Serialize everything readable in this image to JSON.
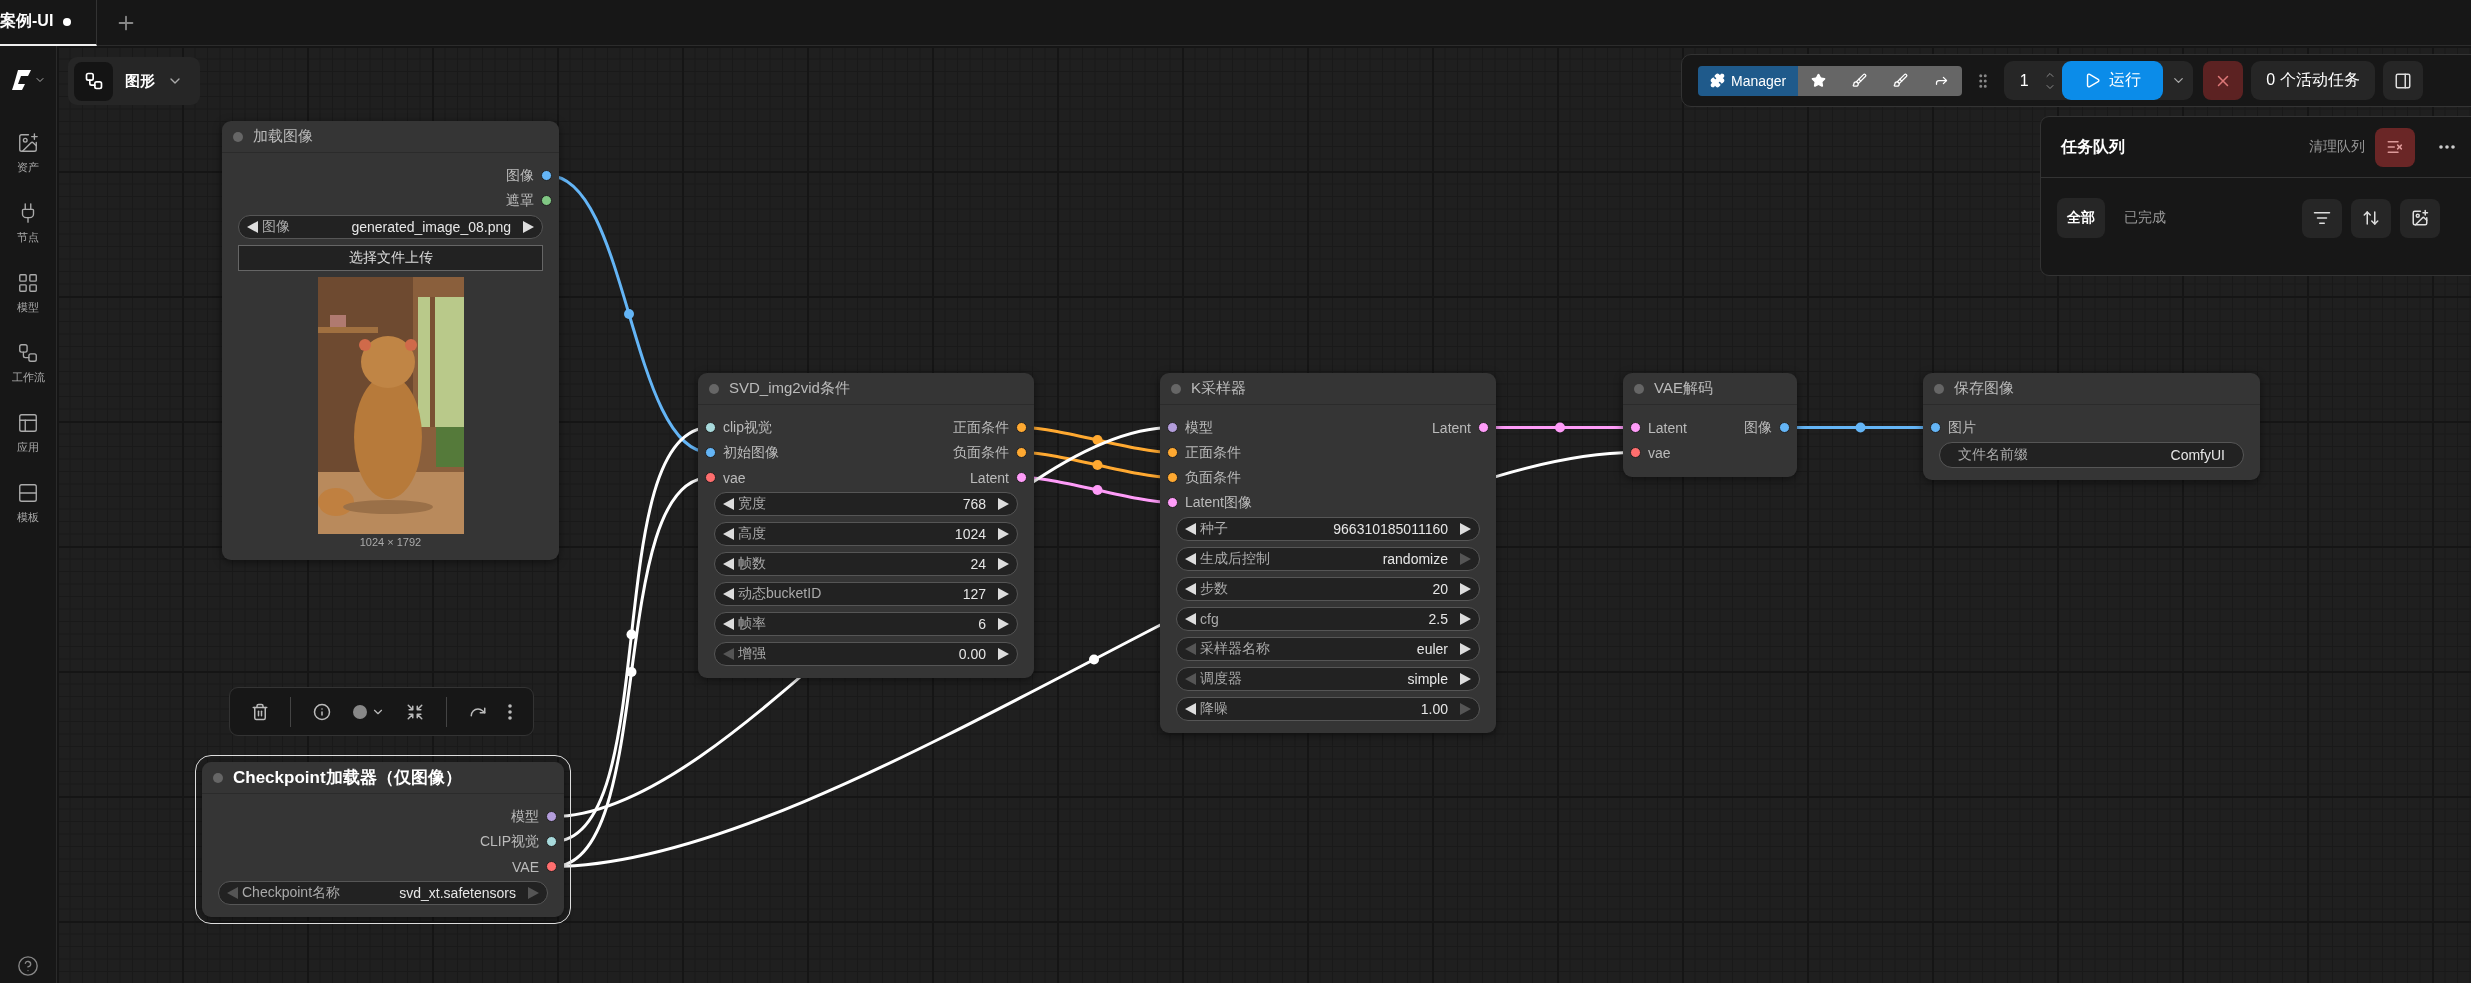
{
  "tabs": [
    {
      "label": "案例-UI",
      "selected": true,
      "modified": true
    }
  ],
  "sidebar": {
    "items": [
      {
        "label": "资产"
      },
      {
        "label": "节点"
      },
      {
        "label": "模型"
      },
      {
        "label": "工作流"
      },
      {
        "label": "应用"
      },
      {
        "label": "模板"
      }
    ]
  },
  "view_switch": {
    "label": "图形"
  },
  "toolbar": {
    "manager": "Manager",
    "batch_count": "1",
    "run": "运行",
    "active_tasks": "0 个活动任务"
  },
  "queue_panel": {
    "title": "任务队列",
    "clear": "清理队列",
    "tabs": [
      {
        "label": "全部",
        "selected": true
      },
      {
        "label": "已完成",
        "selected": false
      }
    ]
  },
  "nodes": [
    {
      "title": "加载图像",
      "selected": false,
      "outputs": [
        {
          "label": "图像",
          "color": "#64b5f6"
        },
        {
          "label": "遮罩",
          "color": "#81c784"
        }
      ],
      "widgets": [
        {
          "kind": "combo",
          "label": "图像",
          "value": "generated_image_08.png",
          "prev_disabled": false,
          "next_disabled": false
        },
        {
          "kind": "button",
          "label": "选择文件上传"
        }
      ],
      "preview": {
        "kind": "picture",
        "caption": "1024 × 1792"
      }
    },
    {
      "title": "SVD_img2vid条件",
      "selected": false,
      "inputs": [
        {
          "label": "clip视觉",
          "color": "#a8dadc"
        },
        {
          "label": "初始图像",
          "color": "#64b5f6"
        },
        {
          "label": "vae",
          "color": "#ff6e6e"
        }
      ],
      "outputs": [
        {
          "label": "正面条件",
          "color": "#ffa931"
        },
        {
          "label": "负面条件",
          "color": "#ffa931"
        },
        {
          "label": "Latent",
          "color": "#ff9cf9"
        }
      ],
      "widgets": [
        {
          "kind": "number",
          "label": "宽度",
          "value": "768",
          "prev_disabled": false,
          "next_disabled": false
        },
        {
          "kind": "number",
          "label": "高度",
          "value": "1024",
          "prev_disabled": false,
          "next_disabled": false
        },
        {
          "kind": "number",
          "label": "帧数",
          "value": "24",
          "prev_disabled": false,
          "next_disabled": false
        },
        {
          "kind": "number",
          "label": "动态bucketID",
          "value": "127",
          "prev_disabled": false,
          "next_disabled": false
        },
        {
          "kind": "number",
          "label": "帧率",
          "value": "6",
          "prev_disabled": false,
          "next_disabled": false
        },
        {
          "kind": "number",
          "label": "增强",
          "value": "0.00",
          "prev_disabled": true,
          "next_disabled": false
        }
      ]
    },
    {
      "title": "K采样器",
      "selected": false,
      "inputs": [
        {
          "label": "模型",
          "color": "#b39ddb"
        },
        {
          "label": "正面条件",
          "color": "#ffa931"
        },
        {
          "label": "负面条件",
          "color": "#ffa931"
        },
        {
          "label": "Latent图像",
          "color": "#ff9cf9"
        }
      ],
      "outputs": [
        {
          "label": "Latent",
          "color": "#ff9cf9"
        }
      ],
      "widgets": [
        {
          "kind": "number",
          "label": "种子",
          "value": "966310185011160",
          "prev_disabled": false,
          "next_disabled": false
        },
        {
          "kind": "combo",
          "label": "生成后控制",
          "value": "randomize",
          "prev_disabled": false,
          "next_disabled": true
        },
        {
          "kind": "number",
          "label": "步数",
          "value": "20",
          "prev_disabled": false,
          "next_disabled": false
        },
        {
          "kind": "number",
          "label": "cfg",
          "value": "2.5",
          "prev_disabled": false,
          "next_disabled": false
        },
        {
          "kind": "combo",
          "label": "采样器名称",
          "value": "euler",
          "prev_disabled": true,
          "next_disabled": false
        },
        {
          "kind": "combo",
          "label": "调度器",
          "value": "simple",
          "prev_disabled": true,
          "next_disabled": false
        },
        {
          "kind": "number",
          "label": "降噪",
          "value": "1.00",
          "prev_disabled": false,
          "next_disabled": true
        }
      ]
    },
    {
      "title": "VAE解码",
      "selected": false,
      "inputs": [
        {
          "label": "Latent",
          "color": "#ff9cf9"
        },
        {
          "label": "vae",
          "color": "#ff6e6e"
        }
      ],
      "outputs": [
        {
          "label": "图像",
          "color": "#64b5f6"
        }
      ]
    },
    {
      "title": "保存图像",
      "selected": false,
      "inputs": [
        {
          "label": "图片",
          "color": "#64b5f6"
        }
      ],
      "widgets": [
        {
          "kind": "text",
          "label": "文件名前缀",
          "value": "ComfyUI"
        }
      ]
    },
    {
      "title": "Checkpoint加载器（仅图像）",
      "selected": true,
      "outputs": [
        {
          "label": "模型",
          "color": "#b39ddb"
        },
        {
          "label": "CLIP视觉",
          "color": "#a8dadc"
        },
        {
          "label": "VAE",
          "color": "#ff6e6e"
        }
      ],
      "widgets": [
        {
          "kind": "combo",
          "label": "Checkpoint名称",
          "value": "svd_xt.safetensors",
          "prev_disabled": true,
          "next_disabled": true
        }
      ]
    }
  ]
}
